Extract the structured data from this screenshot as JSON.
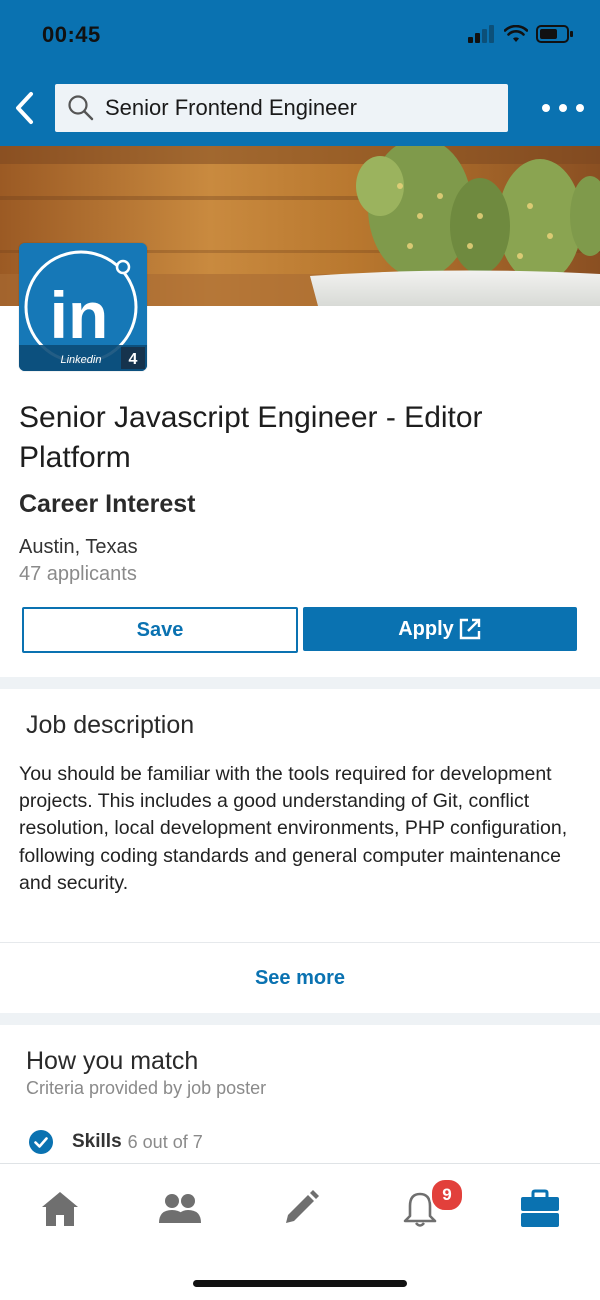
{
  "status_bar": {
    "time": "00:45"
  },
  "nav": {
    "search_value": "Senior Frontend Engineer",
    "back_icon": "chevron-left-icon",
    "more_icon": "more-horizontal-icon"
  },
  "company_logo": {
    "wordmark": "in",
    "caption": "Linkedin",
    "count": "4"
  },
  "job": {
    "title": "Senior Javascript Engineer - Editor Platform",
    "company": "Career Interest",
    "location": "Austin, Texas",
    "applicants": "47 applicants"
  },
  "actions": {
    "save_label": "Save",
    "apply_label": "Apply"
  },
  "description_section": {
    "title": "Job description",
    "text": "You should be familiar with the tools required for development projects. This includes a good understanding of Git, conflict resolution, local development environments, PHP configuration, following coding standards and general computer maintenance and security.",
    "see_more": "See more"
  },
  "match_section": {
    "title": "How you match",
    "subtitle": "Criteria provided by job poster",
    "skills_label": "Skills",
    "skills_count": "6 out of 7"
  },
  "tab_bar": {
    "tabs": [
      {
        "name": "home",
        "icon": "home-icon"
      },
      {
        "name": "my-network",
        "icon": "people-icon"
      },
      {
        "name": "post",
        "icon": "pencil-icon"
      },
      {
        "name": "notifications",
        "icon": "bell-icon"
      },
      {
        "name": "jobs",
        "icon": "briefcase-icon"
      }
    ],
    "notifications_badge": "9"
  },
  "colors": {
    "brand_blue": "#0a72b1",
    "badge_red": "#e2403b",
    "muted_gray": "#8a8a8a",
    "icon_gray": "#6f6f6f"
  }
}
